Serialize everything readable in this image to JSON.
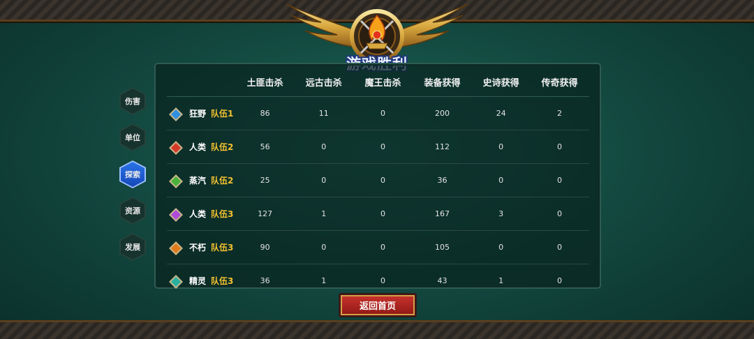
{
  "emblem": {
    "title": "游戏胜利"
  },
  "side_tabs": [
    {
      "label": "伤害",
      "active": false
    },
    {
      "label": "单位",
      "active": false
    },
    {
      "label": "探索",
      "active": true
    },
    {
      "label": "资源",
      "active": false
    },
    {
      "label": "发展",
      "active": false
    }
  ],
  "table": {
    "columns": [
      "土匪击杀",
      "远古击杀",
      "魔王击杀",
      "装备获得",
      "史诗获得",
      "传奇获得"
    ],
    "rows": [
      {
        "gem_color": "#2f8fe0",
        "race": "狂野",
        "squad": "队伍1",
        "values": [
          "86",
          "11",
          "0",
          "200",
          "24",
          "2"
        ]
      },
      {
        "gem_color": "#d23a2a",
        "race": "人类",
        "squad": "队伍2",
        "values": [
          "56",
          "0",
          "0",
          "112",
          "0",
          "0"
        ]
      },
      {
        "gem_color": "#49b23a",
        "race": "蒸汽",
        "squad": "队伍2",
        "values": [
          "25",
          "0",
          "0",
          "36",
          "0",
          "0"
        ]
      },
      {
        "gem_color": "#b04ad8",
        "race": "人类",
        "squad": "队伍3",
        "values": [
          "127",
          "1",
          "0",
          "167",
          "3",
          "0"
        ]
      },
      {
        "gem_color": "#e07a1a",
        "race": "不朽",
        "squad": "队伍3",
        "values": [
          "90",
          "0",
          "0",
          "105",
          "0",
          "0"
        ]
      },
      {
        "gem_color": "#2ab0a0",
        "race": "精灵",
        "squad": "队伍3",
        "values": [
          "36",
          "1",
          "0",
          "43",
          "1",
          "0"
        ]
      }
    ]
  },
  "return_button": {
    "label": "返回首页"
  }
}
